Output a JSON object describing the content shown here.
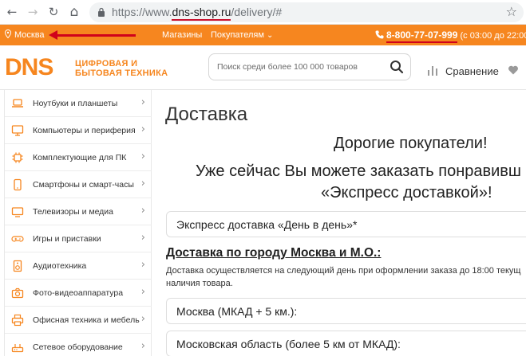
{
  "browser": {
    "back": "←",
    "forward": "→",
    "reload": "↻",
    "home": "⌂",
    "url_prefix": "https://www.",
    "url_host": "dns-shop.ru",
    "url_path": "/delivery/#",
    "star": "☆"
  },
  "topbar": {
    "city": "Москва",
    "stores": "Магазины",
    "buyers": "Покупателям",
    "buyers_caret": "⌄",
    "phone": "8-800-77-07-999",
    "hours": "(с 03:00 до 22:00)"
  },
  "header": {
    "logo": "DNS",
    "tagline_line1": "ЦИФРОВАЯ И",
    "tagline_line2": "БЫТОВАЯ ТЕХНИКА",
    "search_placeholder": "Поиск среди более 100 000 товаров",
    "compare": "Сравнение"
  },
  "sidebar": {
    "items": [
      {
        "label": "Ноутбуки и планшеты",
        "icon": "laptop-icon"
      },
      {
        "label": "Компьютеры и периферия",
        "icon": "monitor-icon"
      },
      {
        "label": "Комплектующие для ПК",
        "icon": "chip-icon"
      },
      {
        "label": "Смартфоны и смарт-часы",
        "icon": "phone-icon"
      },
      {
        "label": "Телевизоры и медиа",
        "icon": "tv-icon"
      },
      {
        "label": "Игры и приставки",
        "icon": "gamepad-icon"
      },
      {
        "label": "Аудиотехника",
        "icon": "speaker-icon"
      },
      {
        "label": "Фото-видеоаппаратура",
        "icon": "camera-icon"
      },
      {
        "label": "Офисная техника и мебель",
        "icon": "printer-icon"
      },
      {
        "label": "Сетевое оборудование",
        "icon": "network-icon"
      }
    ],
    "chevron": "›"
  },
  "main": {
    "title": "Доставка",
    "greeting": "Дорогие покупатели!",
    "promo_line1": "Уже сейчас Вы можете заказать понравивш",
    "promo_line2": "«Экспресс доставкой»!",
    "accordion1": "Экспресс доставка «День в день»*",
    "section_title": "Доставка по городу Москва и М.О.:",
    "section_text1": "Доставка осуществляется на следующий день при оформлении заказа до 18:00 текущ",
    "section_text2": "наличия товара.",
    "accordion2": "Москва (МКАД + 5 км.):",
    "accordion3": "Московская область (более 5 км от МКАД):"
  },
  "colors": {
    "brand_orange": "#f6861f",
    "annotation_red": "#d0021b"
  }
}
